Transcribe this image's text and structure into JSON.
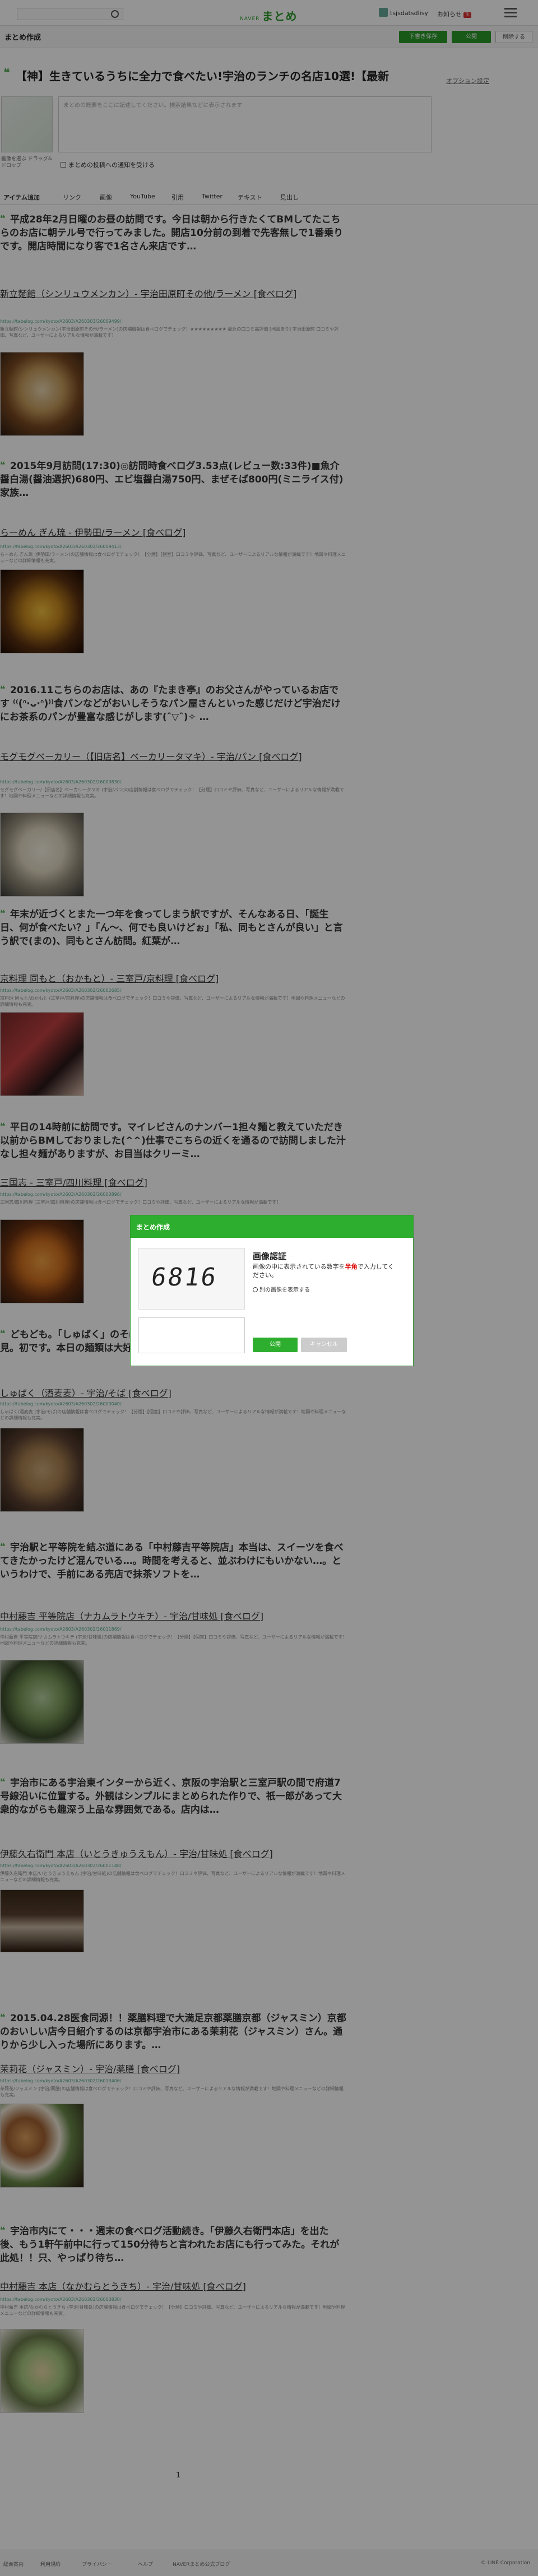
{
  "topbar": {
    "logo_small": "NAVER",
    "logo": "まとめ",
    "user_name": "tsjsdatsdlisy",
    "notice_label": "お知らせ",
    "notice_count": "3"
  },
  "editor": {
    "page_title": "まとめ作成",
    "draft_button": "下書き保存",
    "publish_button": "公開",
    "delete_button": "削除する"
  },
  "matome": {
    "title": "【神】生きているうちに全力で食べたい!宇治のランチの名店10選!【最新",
    "option_link": "オプション設定",
    "thumbnail_caption": "画像を選ぶ ドラッグ&ドロップ",
    "description_placeholder": "まとめの概要をここに記述してください。検索結果などに表示されます",
    "notify_label": "まとめの投稿への通知を受ける"
  },
  "tabs": [
    "アイテム追加",
    "リンク",
    "画像",
    "YouTube",
    "引用",
    "Twitter",
    "テキスト",
    "見出し"
  ],
  "items": [
    {
      "quote": "平成28年2月日曜のお昼の訪問です。今日は朝から行きたくてBMしてたこちらのお店に朝テル号で行ってみました。開店10分前の到着で先客無しで1番乗りです。開店時間になり客で1名さん来店です…",
      "link_title": "新立麺館（シンリュウメンカン）- 宇治田原町その他/ラーメン [食べログ]",
      "link_url": "https://tabelog.com/kyoto/A2603/A260303/26009499/",
      "link_desc": "新立麺館/シンリュウメンカン(宇治田原町その他/ラーメン)の店舗情報は食べログでチェック！★★★★★★★★★ 最近の口コミ高評価 [地図あり] 宇治田原町 口コミや評価、写真など、ユーザーによるリアルな情報が満載です！"
    },
    {
      "quote": "2015年9月訪問(17:30)◎訪問時食べログ3.53点(レビュー数:33件)■魚介醤白湯(醤油選択)680円、エビ塩醤白湯750円、まぜそば800円(ミニライス付)家族…",
      "link_title": "らーめん ぎん琉 - 伊勢田/ラーメン [食べログ]",
      "link_url": "https://tabelog.com/kyoto/A2603/A260302/26009413/",
      "link_desc": "らーめん ぎん琉 (伊勢田/ラーメン)の店舗情報は食べログでチェック！【分煙】【個室】口コミや評価、写真など、ユーザーによるリアルな情報が満載です！地図や料理メニューなどの詳細情報も充実。"
    },
    {
      "quote": "2016.11こちらのお店は、あの『たまき亭』のお父さんがやっているお店です ⁽⁽(ᐢ·ᴗ·ᐢ)⁾⁾食パンなどがおいしそうなパン屋さんといった感じだけど宇治だけにお茶系のパンが豊富な感じがします(ˆ▽ˆ)✧ …",
      "link_title": "モグモグベーカリー（【旧店名】ベーカリータマキ）- 宇治/パン [食べログ]",
      "link_url": "https://tabelog.com/kyoto/A2603/A260302/26003830/",
      "link_desc": "モグモグベーカリー/【旧店名】ベーカリータマキ (宇治/パン)の店舗情報は食べログでチェック！【分煙】口コミや評価、写真など、ユーザーによるリアルな情報が満載です！地図や料理メニューなどの詳細情報も充実。"
    },
    {
      "quote": "年末が近づくとまた一つ年を食ってしまう訳ですが、そんなある日、「誕生日、何が食べたい？」「ん〜、何でも良いけどぉ」「私、同もとさんが良い」と言う訳で(まの)、同もとさん訪問。紅葉が…",
      "link_title": "京料理 同もと（おかもと）- 三室戸/京料理 [食べログ]",
      "link_url": "https://tabelog.com/kyoto/A2603/A260302/26002685/",
      "link_desc": "京料理 同もと/おかもと (三室戸/京料理)の店舗情報は食べログでチェック！口コミや評価、写真など、ユーザーによるリアルな情報が満載です！地図や料理メニューなどの詳細情報も充実。"
    },
    {
      "quote": "平日の14時前に訪問です。マイレビさんのナンバー1担々麺と教えていただき以前からBMしておりました(^^)仕事でこちらの近くを通るので訪問しました汁なし担々麺がありますが、お目当はクリーミ…",
      "link_title": "三国志 - 三室戸/四川料理 [食べログ]",
      "link_url": "https://tabelog.com/kyoto/A2603/A260302/26000896/",
      "link_desc": "三国志/四川料理 (三室戸/四川料理)の店舗情報は食べログでチェック！口コミや評価、写真など、ユーザーによるリアルな情報が満載です！"
    },
    {
      "quote": "どもども。「しゅばく」のそばの選択肢が無いことに気付き、近くのお店を発見。初です。本日の麺類は大好（確か）…",
      "link_title": "しゅばく（酒麦麦）- 宇治/そば [食べログ]",
      "link_url": "https://tabelog.com/kyoto/A2603/A260302/26009040/",
      "link_desc": "しゅばく/酒麦麦 (宇治/そば)の店舗情報は食べログでチェック！【分煙】【個室】口コミや評価、写真など、ユーザーによるリアルな情報が満載です！地図や料理メニューなどの詳細情報も充実。"
    },
    {
      "quote": "宇治駅と平等院を結ぶ道にある「中村藤吉平等院店」本当は、スイーツを食べてきたかったけど混んでいる…。時間を考えると、並ぶわけにもいかない…。というわけで、手前にある売店で抹茶ソフトを…",
      "link_title": "中村藤吉 平等院店（ナカムラトウキチ）- 宇治/甘味処 [食べログ]",
      "link_url": "https://tabelog.com/kyoto/A2603/A260302/26011869/",
      "link_desc": "中村藤吉 平等院店/ナカムラトウキチ (宇治/甘味処)の店舗情報は食べログでチェック！【分煙】【個室】口コミや評価、写真など、ユーザーによるリアルな情報が満載です！地図や料理メニューなどの詳細情報も充実。"
    },
    {
      "quote": "宇治市にある宇治東インターから近く、京阪の宇治駅と三室戸駅の間で府道7号線沿いに位置する。外観はシンプルにまとめられた作りで、祇一郎があって大衆的ながらも趣深う上品な雰囲気である。店内は…",
      "link_title": "伊藤久右衛門 本店（いとうきゅうえもん）- 宇治/甘味処 [食べログ]",
      "link_url": "https://tabelog.com/kyoto/A2603/A260302/26001148/",
      "link_desc": "伊藤久右衛門 本店/いとうきゅうえもん (宇治/甘味処)の店舗情報は食べログでチェック！口コミや評価、写真など、ユーザーによるリアルな情報が満載です！地図や料理メニューなどの詳細情報も充実。"
    },
    {
      "quote": "2015.04.28医食同源！！薬膳料理で大満足京都薬膳京都（ジャスミン）京都のおいしい店今日紹介するのは京都宇治市にある茉莉花（ジャスミン）さん。通りから少し入った場所にあります。…",
      "link_title": "茉莉花（ジャスミン）- 宇治/薬膳 [食べログ]",
      "link_url": "https://tabelog.com/kyoto/A2603/A260302/26013406/",
      "link_desc": "茉莉花/ジャスミン (宇治/薬膳)の店舗情報は食べログでチェック！口コミや評価、写真など、ユーザーによるリアルな情報が満載です！地図や料理メニューなどの詳細情報も充実。"
    },
    {
      "quote": "宇治市内にて・・・週末の食べログ活動続き。「伊藤久右衛門本店」を出た後、もう1軒午前中に行って150分待ちと言われたお店にも行ってみた。それが此処！！只、やっぱり待ち…",
      "link_title": "中村藤吉 本店（なかむらとうきち）- 宇治/甘味処 [食べログ]",
      "link_url": "https://tabelog.com/kyoto/A2603/A260302/26000830/",
      "link_desc": "中村藤吉 本店/なかむらとうきち (宇治/甘味処)の店舗情報は食べログでチェック！【分煙】口コミや評価、写真など、ユーザーによるリアルな情報が満載です！地図や料理メニューなどの詳細情報も充実。"
    }
  ],
  "pager": "1",
  "footer": {
    "links": [
      "総合案内",
      "利用規約",
      "プライバシー",
      "ヘルプ",
      "NAVERまとめ公式ブログ"
    ],
    "copyright": "© LINE Corporation"
  },
  "modal": {
    "header": "まとめ作成",
    "captcha_code": "6816",
    "heading": "画像認証",
    "instruction_before": "画像の中に表示されている数字を",
    "instruction_emph": "半角",
    "instruction_after": "で入力してください。",
    "refresh_label": "別の画像を表示する",
    "ok_button": "公開",
    "cancel_button": "キャンセル"
  },
  "colors": {
    "accent": "#2eae2e",
    "overlay": "#000000",
    "link_url": "#55aa88"
  }
}
